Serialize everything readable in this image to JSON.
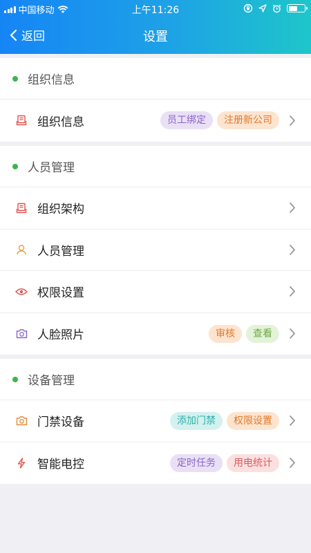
{
  "status_bar": {
    "carrier": "中国移动",
    "time": "上午11:26",
    "battery_level": 0.55
  },
  "navbar": {
    "back_label": "返回",
    "title": "设置"
  },
  "colors": {
    "header_start": "#1585f5",
    "header_end": "#1ec6c9",
    "section_dot": "#3cb54a"
  },
  "sections": [
    {
      "title": "组织信息",
      "rows": [
        {
          "icon": "building-icon",
          "label": "组织信息",
          "tags": [
            {
              "text": "员工绑定",
              "bg": "#e9e0f5",
              "fg": "#8a64c8"
            },
            {
              "text": "注册新公司",
              "bg": "#fde4cf",
              "fg": "#e07a2e"
            }
          ]
        }
      ]
    },
    {
      "title": "人员管理",
      "rows": [
        {
          "icon": "building-icon",
          "label": "组织架构",
          "tags": []
        },
        {
          "icon": "person-icon",
          "label": "人员管理",
          "tags": []
        },
        {
          "icon": "eye-icon",
          "label": "权限设置",
          "tags": []
        },
        {
          "icon": "camera-icon",
          "label": "人脸照片",
          "tags": [
            {
              "text": "审核",
              "bg": "#fde4cf",
              "fg": "#e07a2e"
            },
            {
              "text": "查看",
              "bg": "#e3f3d9",
              "fg": "#6ea843"
            }
          ]
        }
      ]
    },
    {
      "title": "设备管理",
      "rows": [
        {
          "icon": "camera-icon",
          "label": "门禁设备",
          "tags": [
            {
              "text": "添加门禁",
              "bg": "#d3f1ef",
              "fg": "#2fb1a7"
            },
            {
              "text": "权限设置",
              "bg": "#fde4cf",
              "fg": "#e07a2e"
            }
          ]
        },
        {
          "icon": "lightning-icon",
          "label": "智能电控",
          "tags": [
            {
              "text": "定时任务",
              "bg": "#e9e0f5",
              "fg": "#8a64c8"
            },
            {
              "text": "用电统计",
              "bg": "#fbe0e0",
              "fg": "#dd5a5a"
            }
          ]
        }
      ]
    }
  ]
}
